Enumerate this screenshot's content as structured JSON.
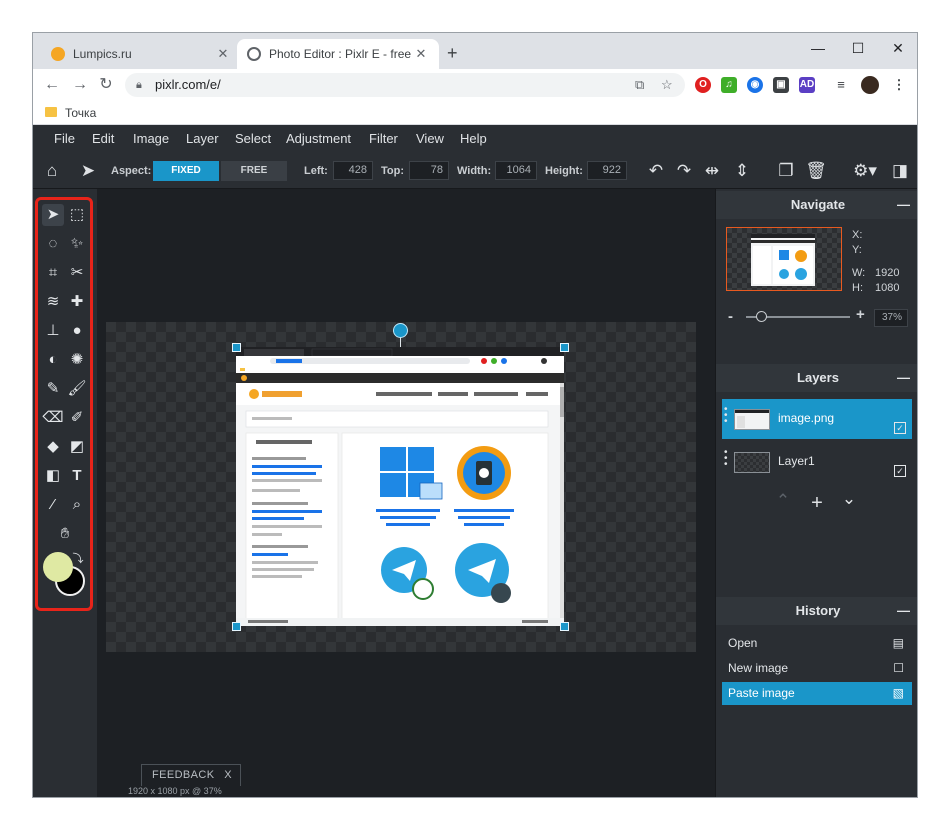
{
  "browser": {
    "tabs": [
      {
        "title": "Lumpics.ru",
        "favicon_color": "#f5a623",
        "active": false
      },
      {
        "title": "Photo Editor : Pixlr E - free image",
        "favicon_color": "#5f6368",
        "active": true
      }
    ],
    "new_tab": "+",
    "url": "pixlr.com/e/",
    "bookmark": "Точка",
    "window_controls": {
      "minimize": "—",
      "maximize": "☐",
      "close": "✕"
    }
  },
  "menu": [
    "File",
    "Edit",
    "Image",
    "Layer",
    "Select",
    "Adjustment",
    "Filter",
    "View",
    "Help"
  ],
  "toolbar": {
    "aspect_label": "Aspect:",
    "fixed": "FIXED",
    "free": "FREE",
    "left_label": "Left:",
    "left": "428",
    "top_label": "Top:",
    "top": "78",
    "width_label": "Width:",
    "width": "1064",
    "height_label": "Height:",
    "height": "922"
  },
  "colors": {
    "accent": "#1a96c9",
    "highlight": "#e8241a",
    "primary_swatch": "#dfe9a3",
    "secondary_swatch": "#000000"
  },
  "navigate": {
    "title": "Navigate",
    "x_label": "X:",
    "y_label": "Y:",
    "w_label": "W:",
    "w": "1920",
    "h_label": "H:",
    "h": "1080",
    "zoom": "37%",
    "zoom_minus": "-",
    "zoom_plus": "+"
  },
  "layers": {
    "title": "Layers",
    "items": [
      {
        "name": "image.png",
        "selected": true
      },
      {
        "name": "Layer1",
        "selected": false
      }
    ]
  },
  "history": {
    "title": "History",
    "items": [
      {
        "label": "Open",
        "selected": false
      },
      {
        "label": "New image",
        "selected": false
      },
      {
        "label": "Paste image",
        "selected": true
      }
    ]
  },
  "canvas": {
    "feedback": "FEEDBACK",
    "feedback_close": "X",
    "status": "1920 x 1080 px @ 37%"
  }
}
